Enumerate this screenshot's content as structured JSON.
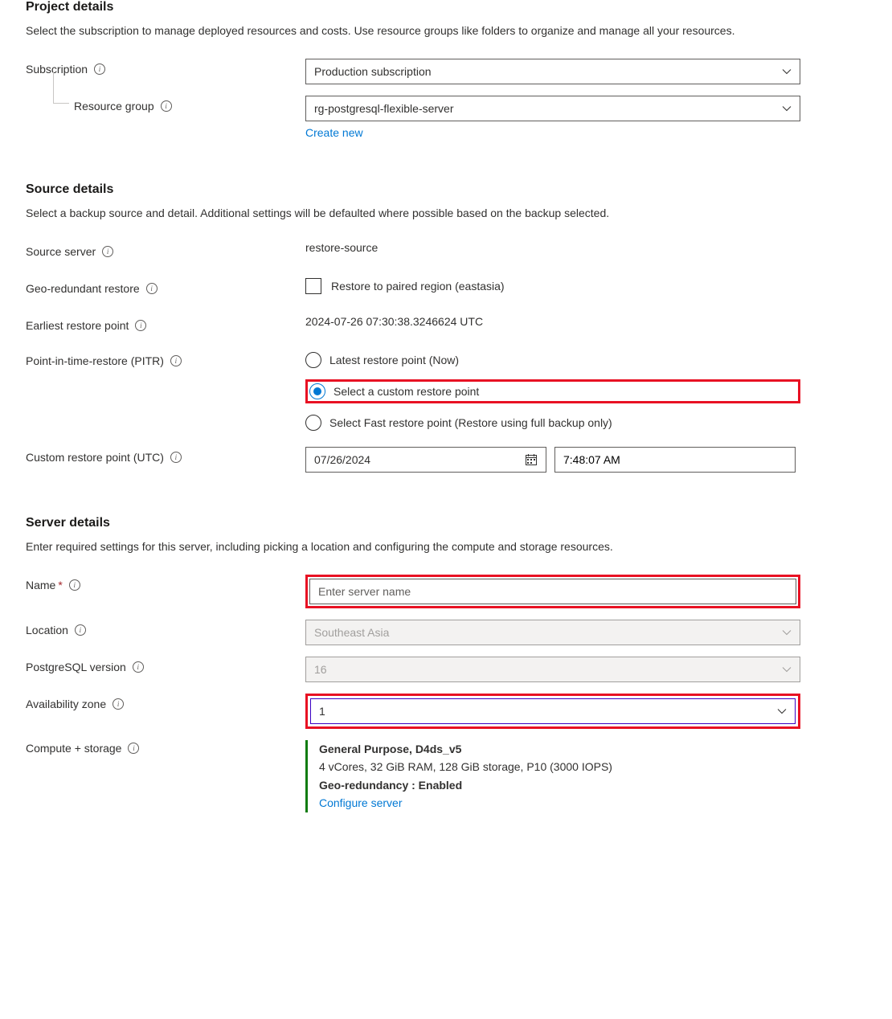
{
  "project": {
    "title": "Project details",
    "desc": "Select the subscription to manage deployed resources and costs. Use resource groups like folders to organize and manage all your resources.",
    "subscription_label": "Subscription",
    "subscription_value": "Production subscription",
    "resource_group_label": "Resource group",
    "resource_group_value": "rg-postgresql-flexible-server",
    "create_new": "Create new"
  },
  "source": {
    "title": "Source details",
    "desc": "Select a backup source and detail. Additional settings will be defaulted where possible based on the backup selected.",
    "source_server_label": "Source server",
    "source_server_value": "restore-source",
    "geo_restore_label": "Geo-redundant restore",
    "geo_restore_checkbox_label": "Restore to paired region (eastasia)",
    "earliest_label": "Earliest restore point",
    "earliest_value": "2024-07-26 07:30:38.3246624 UTC",
    "pitr_label": "Point-in-time-restore (PITR)",
    "pitr_options": {
      "latest": "Latest restore point (Now)",
      "custom": "Select a custom restore point",
      "fast": "Select Fast restore point (Restore using full backup only)"
    },
    "custom_point_label": "Custom restore point (UTC)",
    "custom_date": "07/26/2024",
    "custom_time": "7:48:07 AM"
  },
  "server": {
    "title": "Server details",
    "desc": "Enter required settings for this server, including picking a location and configuring the compute and storage resources.",
    "name_label": "Name",
    "name_placeholder": "Enter server name",
    "location_label": "Location",
    "location_value": "Southeast Asia",
    "pg_version_label": "PostgreSQL version",
    "pg_version_value": "16",
    "az_label": "Availability zone",
    "az_value": "1",
    "compute_label": "Compute + storage",
    "compute_tier": "General Purpose, D4ds_v5",
    "compute_specs": "4 vCores, 32 GiB RAM, 128 GiB storage, P10 (3000 IOPS)",
    "geo_redundancy": "Geo-redundancy : Enabled",
    "configure_link": "Configure server"
  }
}
